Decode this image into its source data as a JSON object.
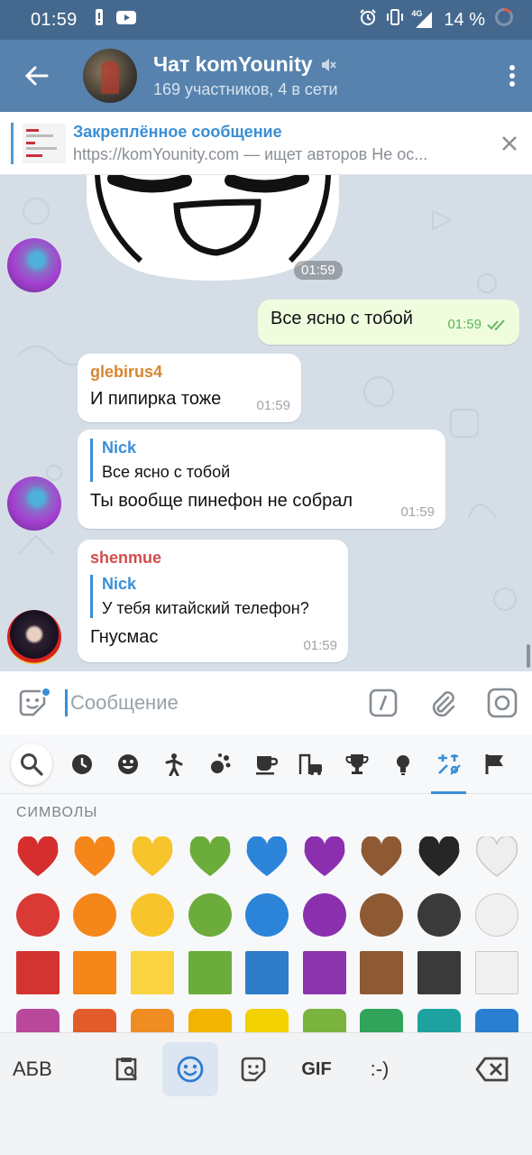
{
  "status_bar": {
    "time": "01:59",
    "network": "4G",
    "battery": "14 %",
    "icons": [
      "alert-icon",
      "youtube-icon",
      "alarm-icon",
      "vibrate-icon",
      "signal-icon",
      "battery-icon"
    ]
  },
  "header": {
    "title": "Чат komYounity",
    "subtitle": "169 участников, 4 в сети",
    "muted": true
  },
  "pinned": {
    "title": "Закреплённое сообщение",
    "text": "https://komYounity.com — ищет авторов  Не ос..."
  },
  "chat": {
    "sticker_time": "01:59",
    "messages": [
      {
        "direction": "out",
        "text": "Все ясно с тобой",
        "time": "01:59",
        "read": true
      },
      {
        "direction": "in",
        "sender": "glebirus4",
        "sender_color": "#d9852f",
        "text": "И пипирка тоже",
        "time": "01:59"
      },
      {
        "direction": "in",
        "reply_name": "Nick",
        "reply_text": "Все ясно с тобой",
        "text": "Ты вообще пинефон не собрал",
        "time": "01:59"
      },
      {
        "direction": "in",
        "sender": "shenmue",
        "sender_color": "#d34d4d",
        "reply_name": "Nick",
        "reply_text": "У тебя китайский телефон?",
        "text": "Гнусмас",
        "time": "01:59"
      }
    ]
  },
  "input": {
    "placeholder": "Сообщение",
    "value": ""
  },
  "emoji_panel": {
    "section_title": "СИМВОЛЫ",
    "categories": [
      "search",
      "recent",
      "smileys",
      "people",
      "animals",
      "food",
      "travel",
      "activities",
      "objects",
      "symbols",
      "flags"
    ],
    "active_category": "symbols",
    "hearts": [
      "#d62e2e",
      "#f4861a",
      "#f7c42b",
      "#6bac3b",
      "#2c84d9",
      "#8b2fae",
      "#8e5a33",
      "#262626",
      "#eeeeee"
    ],
    "circles": [
      "#d93a36",
      "#f4861a",
      "#f7c42b",
      "#6bac3b",
      "#2c84d9",
      "#8b2fae",
      "#8e5a33",
      "#3a3a3a",
      "#f0f0f0"
    ],
    "squares": [
      "#d33331",
      "#f4861a",
      "#f9d341",
      "#6bac3b",
      "#2f7dc8",
      "#8b35ae",
      "#8e5a33",
      "#3a3a3a",
      "#f0f0f0"
    ]
  },
  "keyboard_bar": {
    "abc_label": "АБВ",
    "gif_label": "GIF",
    "emoticon_label": ":-)"
  }
}
